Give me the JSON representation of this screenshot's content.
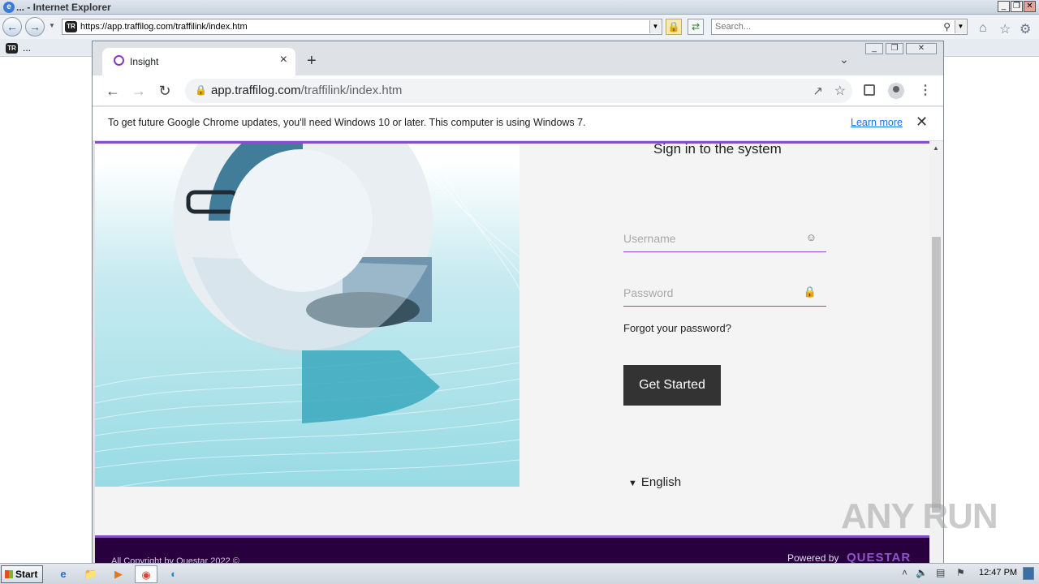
{
  "ie": {
    "title": "... - Internet Explorer",
    "address_url": "https://app.traffilog.com/traffilink/index.htm",
    "search_placeholder": "Search...",
    "tab_label": "...",
    "favicon_text": "TR",
    "win_minimize": "_",
    "win_restore": "❐",
    "win_close": "✕"
  },
  "chrome": {
    "tab_title": "Insight",
    "url_host": "app.traffilog.com",
    "url_path": "/traffilink/index.htm",
    "infobar_text": "To get future Google Chrome updates, you'll need Windows 10 or later. This computer is using Windows 7.",
    "infobar_link": "Learn more"
  },
  "page": {
    "signin_title": "Sign in to the system",
    "username_placeholder": "Username",
    "password_placeholder": "Password",
    "forgot_password": "Forgot your password?",
    "get_started": "Get Started",
    "language": "English",
    "footer_copyright": "All Copyright by Questar 2022 ©",
    "footer_powered": "Powered by",
    "footer_logo": "QUESTAR"
  },
  "watermark": "ANY RUN",
  "taskbar": {
    "start_label": "Start",
    "clock": "12:47 PM"
  },
  "colors": {
    "accent_purple": "#8a4cc8",
    "footer_bg": "#28003e",
    "button_dark": "#333333",
    "hero_teal": "#98dbe4"
  }
}
